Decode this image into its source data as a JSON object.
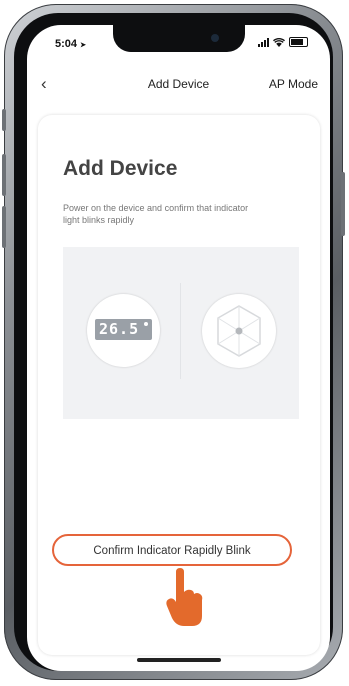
{
  "status_bar": {
    "time": "5:04",
    "location_arrow": "➤"
  },
  "nav": {
    "back_icon": "‹",
    "title": "Add Device",
    "right_action": "AP Mode"
  },
  "content": {
    "title": "Add Device",
    "instruction": "Power on the device and confirm that indicator light blinks rapidly",
    "device_display": "26.5",
    "confirm_button": "Confirm Indicator Rapidly Blink"
  },
  "colors": {
    "accent": "#e5643a",
    "hand": "#e36a2c",
    "illustration_bg": "#f1f2f4"
  },
  "icons": [
    "back-chevron-icon",
    "signal-icon",
    "wifi-icon",
    "battery-icon",
    "pointing-hand-icon"
  ]
}
